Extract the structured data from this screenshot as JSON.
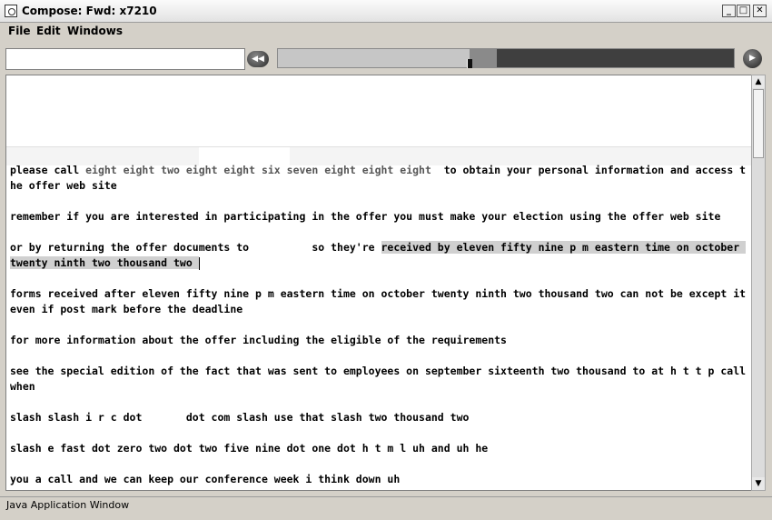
{
  "window": {
    "title": "Compose: Fwd: x7210",
    "buttons": {
      "minimize": "_",
      "maximize": "□",
      "close": "✕"
    }
  },
  "menubar": {
    "items": [
      "File",
      "Edit",
      "Windows"
    ]
  },
  "toolbar": {
    "address_value": "",
    "rewind_icon": "◀◀",
    "play_icon": "▶",
    "progress_fraction": 0.42,
    "buffer_fraction": 0.48
  },
  "editor": {
    "paragraphs": [
      {
        "parts": [
          {
            "text": "please call ",
            "style": "normal"
          },
          {
            "text": "eight eight two eight eight six seven eight eight eight ",
            "style": "num"
          },
          {
            "text": " to obtain your personal information and access the offer web site",
            "style": "normal"
          }
        ]
      },
      {
        "parts": [
          {
            "text": "remember if you are interested in participating in the offer you must make your election using the offer web site",
            "style": "normal"
          }
        ]
      },
      {
        "parts": [
          {
            "text": "or by returning the offer documents to          so they're ",
            "style": "normal"
          },
          {
            "text": "received by eleven fifty nine p m eastern time on october twenty ninth two thousand two ",
            "style": "sel"
          }
        ],
        "cursor": true
      },
      {
        "parts": [
          {
            "text": "forms received after eleven fifty nine p m eastern time on october twenty ninth two thousand two can not be except it even if post mark before the deadline",
            "style": "normal"
          }
        ]
      },
      {
        "parts": [
          {
            "text": "for more information about the offer including the eligible of the requirements",
            "style": "normal"
          }
        ]
      },
      {
        "parts": [
          {
            "text": "see the special edition of the fact that was sent to employees on september sixteenth two thousand to at h t t p call when",
            "style": "normal"
          }
        ]
      },
      {
        "parts": [
          {
            "text": "slash slash i r c dot       dot com slash use that slash two thousand two",
            "style": "normal"
          }
        ]
      },
      {
        "parts": [
          {
            "text": "slash e fast dot zero two dot two five nine dot one dot h t m l uh and uh he",
            "style": "normal"
          }
        ]
      },
      {
        "parts": [
          {
            "text": "you a call and we can keep our conference week i think down uh",
            "style": "normal"
          }
        ]
      }
    ]
  },
  "scrollbar": {
    "up_icon": "▲",
    "down_icon": "▼"
  },
  "status": {
    "text": "Java Application Window"
  }
}
